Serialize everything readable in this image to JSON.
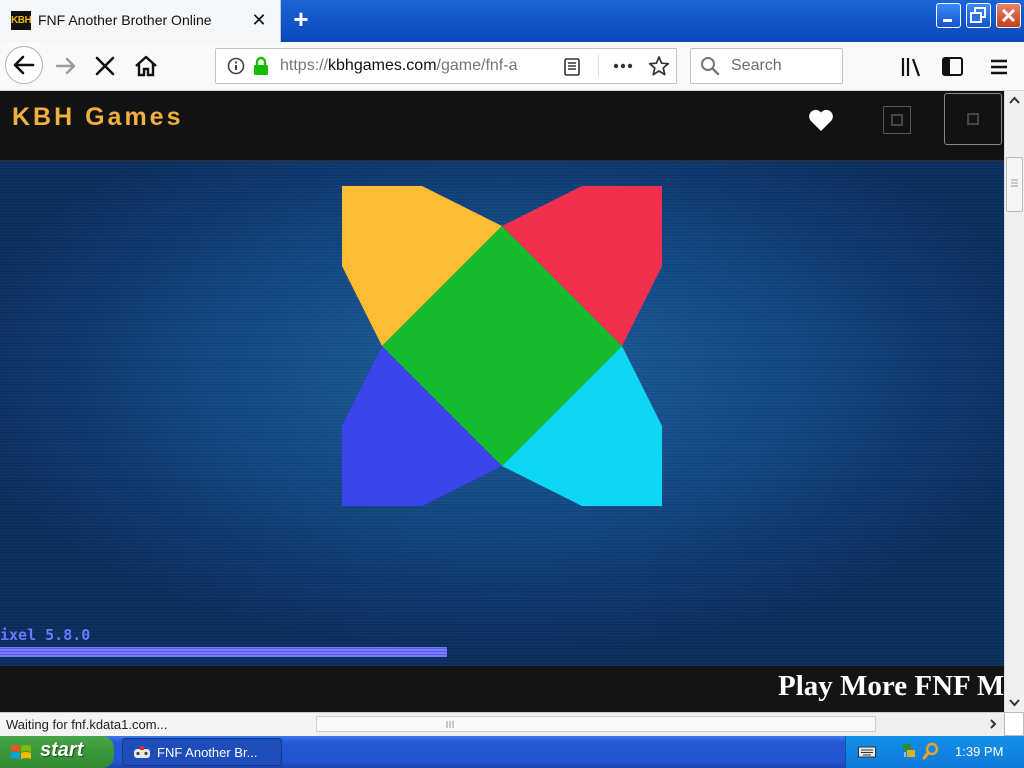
{
  "browser": {
    "tab": {
      "icon_text": "KBH",
      "title": "FNF Another Brother Online"
    },
    "url": {
      "prefix": "https://",
      "domain": "kbhgames.com",
      "path": "/game/fnf-a"
    },
    "search_placeholder": "Search"
  },
  "site": {
    "logo": "KBH Games"
  },
  "game": {
    "loader_label": "ixel 5.8.0",
    "loader_progress": 0.445,
    "logo_colors": {
      "top_left": "#fcbc33",
      "top_right": "#f0304c",
      "center": "#14bc2c",
      "bottom_left": "#3c44ec",
      "bottom_right": "#0cd8f4"
    }
  },
  "banner": {
    "text": "Play More FNF M"
  },
  "status": {
    "text": "Waiting for fnf.kdata1.com..."
  },
  "taskbar": {
    "start_label": "start",
    "task_label": "FNF Another Br...",
    "clock": "1:39 PM"
  }
}
